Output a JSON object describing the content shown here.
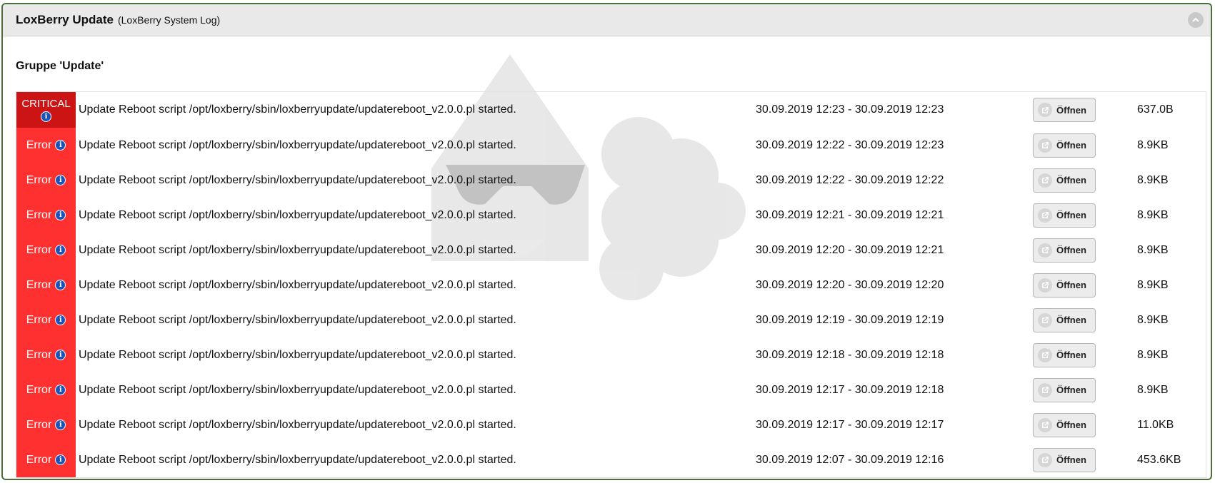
{
  "header": {
    "title": "LoxBerry Update",
    "subtitle": "(LoxBerry System Log)"
  },
  "group": {
    "title": "Gruppe 'Update'"
  },
  "rows": [
    {
      "level": "CRITICAL",
      "message": "Update Reboot script /opt/loxberry/sbin/loxberryupdate/updatereboot_v2.0.0.pl started.",
      "timerange": "30.09.2019 12:23 - 30.09.2019 12:23",
      "button": "Öffnen",
      "size": "637.0B"
    },
    {
      "level": "Error",
      "message": "Update Reboot script /opt/loxberry/sbin/loxberryupdate/updatereboot_v2.0.0.pl started.",
      "timerange": "30.09.2019 12:22 - 30.09.2019 12:23",
      "button": "Öffnen",
      "size": "8.9KB"
    },
    {
      "level": "Error",
      "message": "Update Reboot script /opt/loxberry/sbin/loxberryupdate/updatereboot_v2.0.0.pl started.",
      "timerange": "30.09.2019 12:22 - 30.09.2019 12:22",
      "button": "Öffnen",
      "size": "8.9KB"
    },
    {
      "level": "Error",
      "message": "Update Reboot script /opt/loxberry/sbin/loxberryupdate/updatereboot_v2.0.0.pl started.",
      "timerange": "30.09.2019 12:21 - 30.09.2019 12:21",
      "button": "Öffnen",
      "size": "8.9KB"
    },
    {
      "level": "Error",
      "message": "Update Reboot script /opt/loxberry/sbin/loxberryupdate/updatereboot_v2.0.0.pl started.",
      "timerange": "30.09.2019 12:20 - 30.09.2019 12:21",
      "button": "Öffnen",
      "size": "8.9KB"
    },
    {
      "level": "Error",
      "message": "Update Reboot script /opt/loxberry/sbin/loxberryupdate/updatereboot_v2.0.0.pl started.",
      "timerange": "30.09.2019 12:20 - 30.09.2019 12:20",
      "button": "Öffnen",
      "size": "8.9KB"
    },
    {
      "level": "Error",
      "message": "Update Reboot script /opt/loxberry/sbin/loxberryupdate/updatereboot_v2.0.0.pl started.",
      "timerange": "30.09.2019 12:19 - 30.09.2019 12:19",
      "button": "Öffnen",
      "size": "8.9KB"
    },
    {
      "level": "Error",
      "message": "Update Reboot script /opt/loxberry/sbin/loxberryupdate/updatereboot_v2.0.0.pl started.",
      "timerange": "30.09.2019 12:18 - 30.09.2019 12:18",
      "button": "Öffnen",
      "size": "8.9KB"
    },
    {
      "level": "Error",
      "message": "Update Reboot script /opt/loxberry/sbin/loxberryupdate/updatereboot_v2.0.0.pl started.",
      "timerange": "30.09.2019 12:17 - 30.09.2019 12:18",
      "button": "Öffnen",
      "size": "8.9KB"
    },
    {
      "level": "Error",
      "message": "Update Reboot script /opt/loxberry/sbin/loxberryupdate/updatereboot_v2.0.0.pl started.",
      "timerange": "30.09.2019 12:17 - 30.09.2019 12:17",
      "button": "Öffnen",
      "size": "11.0KB"
    },
    {
      "level": "Error",
      "message": "Update Reboot script /opt/loxberry/sbin/loxberryupdate/updatereboot_v2.0.0.pl started.",
      "timerange": "30.09.2019 12:07 - 30.09.2019 12:16",
      "button": "Öffnen",
      "size": "453.6KB"
    }
  ],
  "colors": {
    "critical": "#cc1414",
    "error": "#ff3030",
    "border": "#4a6f3a"
  },
  "icons": {
    "collapse": "chevron-up-icon",
    "info": "info-icon",
    "open": "external-link-icon",
    "watermark": "loxberry-logo-watermark"
  }
}
